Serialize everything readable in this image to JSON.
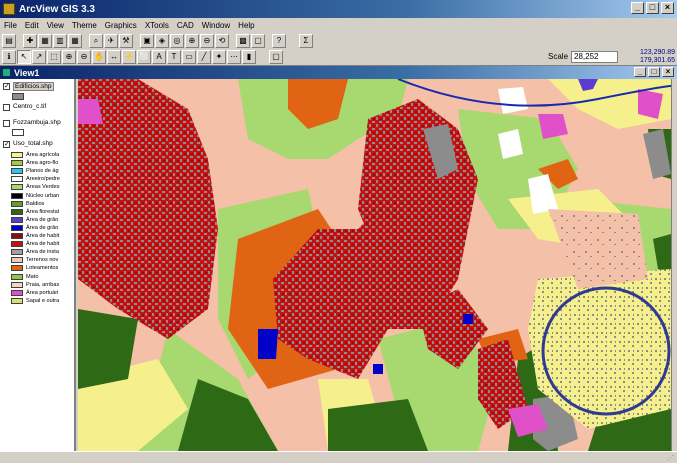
{
  "app": {
    "title": "ArcView GIS 3.3"
  },
  "window_buttons": [
    "_",
    "□",
    "×"
  ],
  "menu": [
    "File",
    "Edit",
    "View",
    "Theme",
    "Graphics",
    "XTools",
    "CAD",
    "Window",
    "Help"
  ],
  "toolbar": {
    "scale_label": "Scale 1:",
    "scale_value": "28,252",
    "coord_x": "123,290.89",
    "coord_y": "179,301.65",
    "sum_label": "Σ",
    "help_label": "?"
  },
  "view": {
    "title": "View1"
  },
  "toc": {
    "themes": [
      {
        "name": "Edificios.shp",
        "checked": true
      },
      {
        "name": "Centro_c.tif",
        "checked": false
      },
      {
        "name": "Fozzambuja.shp",
        "checked": false
      },
      {
        "name": "Uso_total.shp",
        "checked": true
      }
    ],
    "legend": [
      {
        "label": "Área agrícola",
        "color": "#f6f08c"
      },
      {
        "label": "Área agro-flo",
        "color": "#a8c83c"
      },
      {
        "label": "Planos de ág",
        "color": "#28c8e8"
      },
      {
        "label": "Areeiro/pedre",
        "color": "#ffffff"
      },
      {
        "label": "Áreas Verdes",
        "color": "#a8d870"
      },
      {
        "label": "Núcleo urban",
        "color": "#000000"
      },
      {
        "label": "Baldios",
        "color": "#6a9a2a"
      },
      {
        "label": "Área florestal",
        "color": "#2e6a16"
      },
      {
        "label": "Área de grân",
        "color": "#5a3cd0"
      },
      {
        "label": "Área de grân",
        "color": "#0000c8"
      },
      {
        "label": "Área de habit",
        "color": "#8c0a12"
      },
      {
        "label": "Área de habit",
        "color": "#c81010"
      },
      {
        "label": "Área de insta",
        "color": "#a0a0a0"
      },
      {
        "label": "Terrenos nov",
        "color": "#f0c8b8"
      },
      {
        "label": "Loteamentos",
        "color": "#e06414"
      },
      {
        "label": "Mato",
        "color": "#8cc850"
      },
      {
        "label": "Praia, arribas",
        "color": "#f0d8c0"
      },
      {
        "label": "Área portuári",
        "color": "#e050c8"
      },
      {
        "label": "Sapal e outra",
        "color": "#d8e070"
      }
    ]
  },
  "colors": {
    "agricultural": "#f6f08c",
    "green_areas": "#a8d870",
    "forest": "#2e6a16",
    "urban_red": "#c81010",
    "building_gray": "#8c8c8c",
    "lots_orange": "#e06414",
    "new_terrain": "#f4c0a8",
    "circle_outline": "#303a90"
  }
}
